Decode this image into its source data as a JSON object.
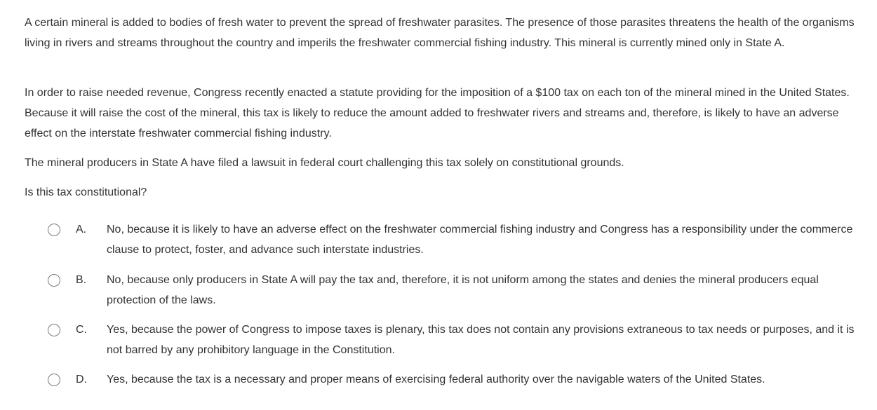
{
  "stem": {
    "p1": "A certain mineral is added to bodies of fresh water to prevent the spread of freshwater parasites.  The presence of those parasites threatens the health of the organisms living in rivers and streams throughout the country and imperils the freshwater commercial fishing industry.  This mineral is currently mined only in State A.",
    "p2": "In order to raise needed revenue, Congress recently enacted a statute providing for the imposition of a $100 tax on each ton of the mineral mined in the United States.  Because it will raise the cost of the mineral, this tax is likely to reduce the amount added to freshwater rivers and streams and, therefore, is likely to have an adverse effect on the interstate freshwater commercial fishing industry.",
    "p3": "The mineral producers in State A have filed a lawsuit in federal court challenging this tax solely on constitutional grounds.",
    "question": "Is this tax constitutional?"
  },
  "options": [
    {
      "letter": "A.",
      "text": "No, because it is likely to have an adverse effect on the freshwater commercial fishing industry and Congress has a responsibility under the commerce clause to protect, foster, and advance such interstate industries."
    },
    {
      "letter": "B.",
      "text": "No, because only producers in State A will pay the tax and, therefore, it is not uniform among the states and denies the mineral producers equal protection of the laws."
    },
    {
      "letter": "C.",
      "text": "Yes, because the power of Congress to impose taxes is plenary, this tax does not contain any provisions extraneous to tax needs or purposes, and it is not barred by any prohibitory language in the Constitution."
    },
    {
      "letter": "D.",
      "text": "Yes, because the tax is a necessary and proper means of exercising federal authority over the navigable waters of the United States."
    }
  ]
}
